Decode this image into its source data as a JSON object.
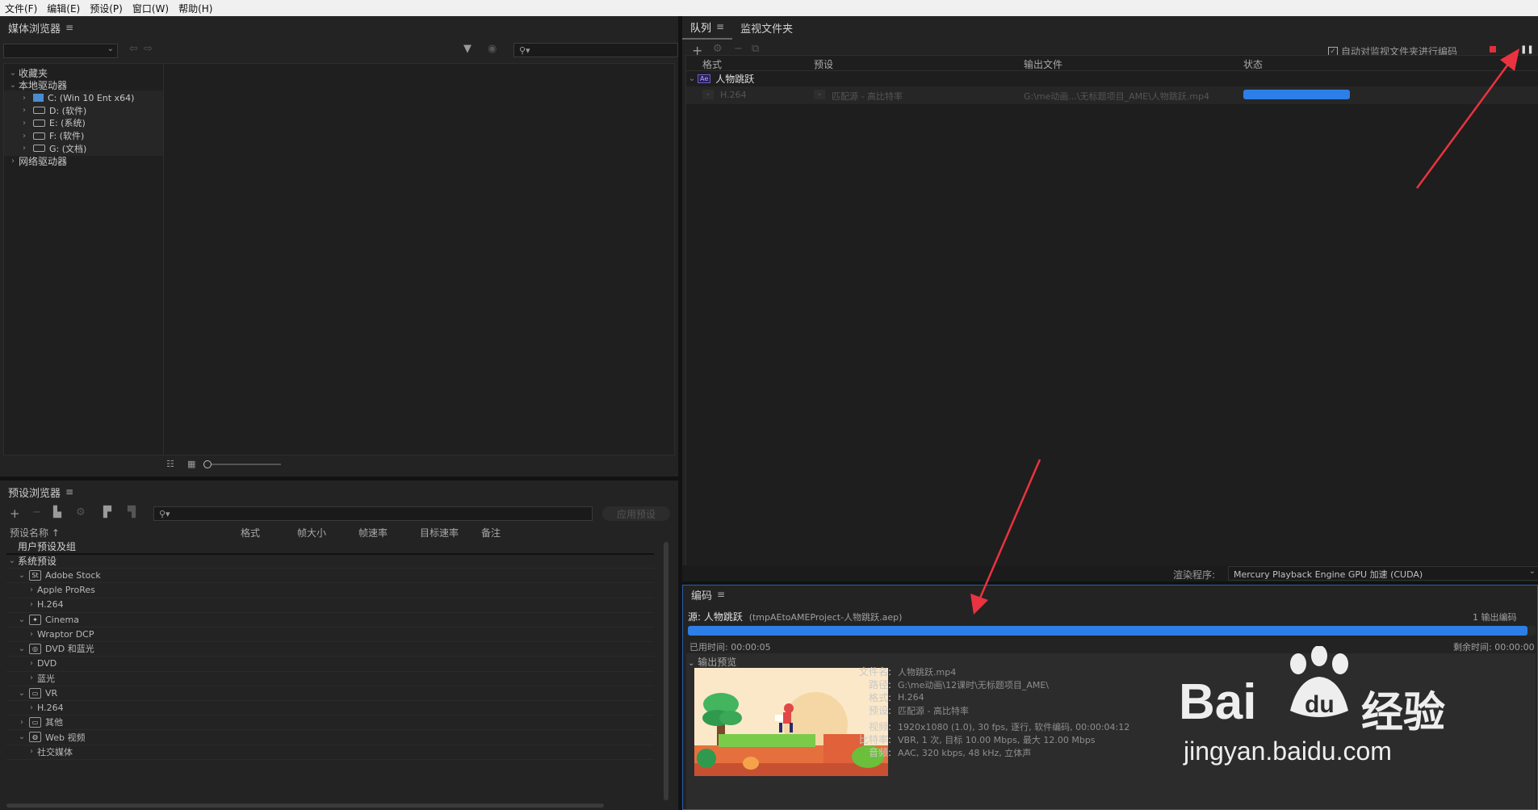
{
  "menubar": [
    "文件(F)",
    "编辑(E)",
    "预设(P)",
    "窗口(W)",
    "帮助(H)"
  ],
  "media_browser": {
    "title": "媒体浏览器",
    "tree": [
      {
        "label": "收藏夹",
        "level": 0,
        "expanded": true
      },
      {
        "label": "本地驱动器",
        "level": 0,
        "expanded": true
      },
      {
        "label": "C: (Win 10 Ent x64)",
        "level": 1,
        "icon": "windows-drive-icon"
      },
      {
        "label": "D: (软件)",
        "level": 1,
        "icon": "drive-icon"
      },
      {
        "label": "E: (系统)",
        "level": 1,
        "icon": "drive-icon"
      },
      {
        "label": "F: (软件)",
        "level": 1,
        "icon": "drive-icon"
      },
      {
        "label": "G: (文档)",
        "level": 1,
        "icon": "drive-icon"
      },
      {
        "label": "网络驱动器",
        "level": 0,
        "expanded": false
      }
    ]
  },
  "preset_browser": {
    "title": "预设浏览器",
    "apply_label": "应用预设",
    "columns": [
      "预设名称 ↑",
      "格式",
      "帧大小",
      "帧速率",
      "目标速率",
      "备注"
    ],
    "rows": [
      {
        "label": "用户预设及组",
        "level": 0,
        "group": true
      },
      {
        "label": "系统预设",
        "level": 0,
        "group": true
      },
      {
        "label": "Adobe Stock",
        "level": 1,
        "icon": "St"
      },
      {
        "label": "Apple ProRes",
        "level": 2
      },
      {
        "label": "H.264",
        "level": 2
      },
      {
        "label": "Cinema",
        "level": 1,
        "icon": "cinema"
      },
      {
        "label": "Wraptor DCP",
        "level": 2
      },
      {
        "label": "DVD 和蓝光",
        "level": 1,
        "icon": "disc"
      },
      {
        "label": "DVD",
        "level": 2
      },
      {
        "label": "蓝光",
        "level": 2
      },
      {
        "label": "VR",
        "level": 1,
        "icon": "vr"
      },
      {
        "label": "H.264",
        "level": 2
      },
      {
        "label": "其他",
        "level": 1,
        "icon": "monitor"
      },
      {
        "label": "Web 视频",
        "level": 1,
        "icon": "globe"
      },
      {
        "label": "社交媒体",
        "level": 2
      }
    ]
  },
  "queue": {
    "tabs": [
      "队列",
      "监视文件夹"
    ],
    "auto_encode_label": "自动对监视文件夹进行编码",
    "columns": [
      "格式",
      "预设",
      "输出文件",
      "状态"
    ],
    "item_name": "人物跳跃",
    "item_badge": "Ae",
    "row": {
      "format": "H.264",
      "preset": "匹配源 - 高比特率",
      "output": "G:\\me动画...\\无标题项目_AME\\人物跳跃.mp4",
      "progress": 1.0
    },
    "renderer_label": "渲染程序:",
    "renderer_value": "Mercury Playback Engine GPU 加速 (CUDA)"
  },
  "encoding": {
    "title": "编码",
    "source_label": "源: 人物跳跃",
    "source_project": "(tmpAEtoAMEProject-人物跳跃.aep)",
    "outputs_count": "1 输出编码",
    "progress": 0.99,
    "elapsed_label": "已用时间: 00:00:05",
    "remaining_label": "剩余时间: 00:00:00",
    "preview_label": "输出预览",
    "info": [
      {
        "key": "文件名:",
        "value": "人物跳跃.mp4"
      },
      {
        "key": "路径:",
        "value": "G:\\me动画\\12课时\\无标题项目_AME\\"
      },
      {
        "key": "格式:",
        "value": "H.264"
      },
      {
        "key": "预设:",
        "value": "匹配源 - 高比特率"
      },
      {
        "key": "视频:",
        "value": "1920x1080 (1.0), 30 fps, 逐行, 软件编码, 00:00:04:12"
      },
      {
        "key": "比特率:",
        "value": "VBR, 1 次, 目标 10.00 Mbps, 最大 12.00 Mbps"
      },
      {
        "key": "音频:",
        "value": "AAC, 320 kbps, 48 kHz, 立体声"
      }
    ]
  },
  "watermark": {
    "brand": "Bai",
    "brand2": "经验",
    "url": "jingyan.baidu.com"
  },
  "colors": {
    "accent": "#2d7ee6",
    "stop": "#e0303a",
    "arrow": "#ea3340"
  }
}
